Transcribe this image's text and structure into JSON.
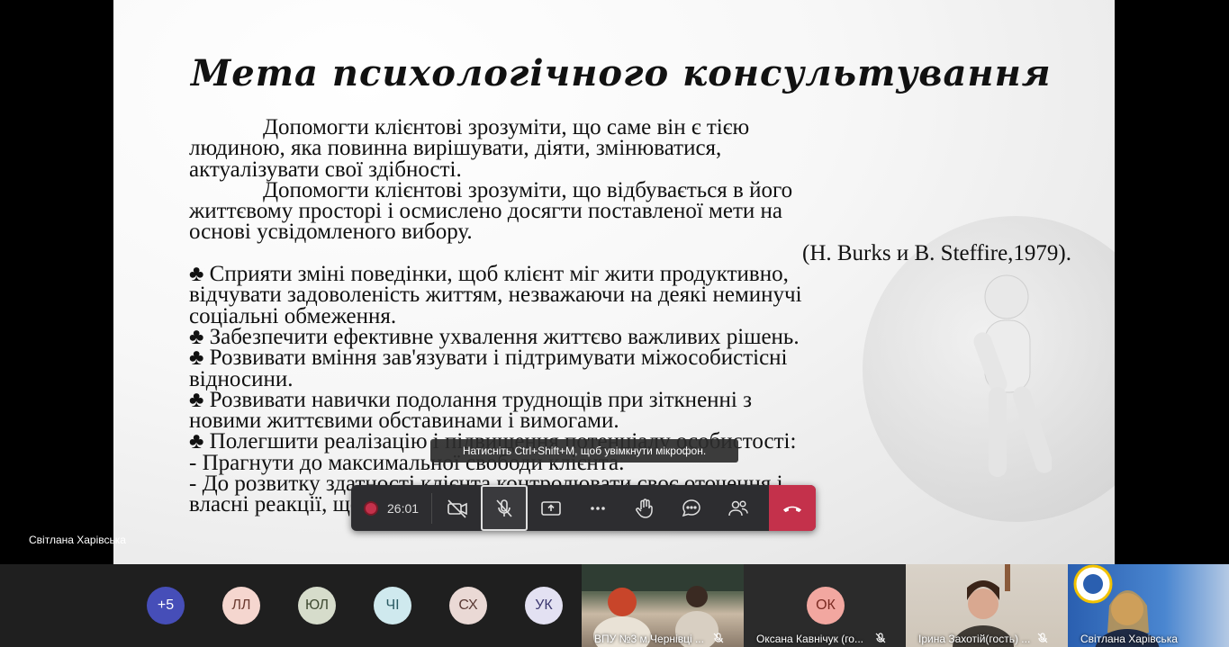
{
  "slide": {
    "title": "Мета психологічного консультування",
    "lines": [
      {
        "text": "Допомогти клієнтові зрозуміти, що саме він є тією",
        "cls": "indent"
      },
      {
        "text": "людиною, яка повинна вирішувати, діяти, змінюватися,",
        "cls": ""
      },
      {
        "text": "актуалізувати свої здібності.",
        "cls": ""
      },
      {
        "text": "Допомогти клієнтові зрозуміти, що відбувається в його",
        "cls": "indent"
      },
      {
        "text": "життєвому просторі і осмислено досягти поставленої мети на",
        "cls": ""
      },
      {
        "text": "основі усвідомленого вибору.",
        "cls": ""
      },
      {
        "text": "(H. Burks и B. Steffire,1979).",
        "cls": "citation"
      },
      {
        "text": "♣ Сприяти зміні поведінки, щоб клієнт міг жити продуктивно,",
        "cls": ""
      },
      {
        "text": "відчувати задоволеність життям, незважаючи на деякі неминучі",
        "cls": ""
      },
      {
        "text": "соціальні обмеження.",
        "cls": ""
      },
      {
        "text": "♣ Забезпечити ефективне ухвалення життєво важливих рішень.",
        "cls": ""
      },
      {
        "text": "♣ Розвивати вміння зав'язувати і підтримувати міжособистісні",
        "cls": ""
      },
      {
        "text": "відносини.",
        "cls": ""
      },
      {
        "text": "♣ Розвивати навички подолання труднощів при зіткненні з",
        "cls": ""
      },
      {
        "text": "новими життєвими обставинами і вимогами.",
        "cls": ""
      },
      {
        "text": "♣ Полегшити реалізацію і підвищення потенціалу особистості:",
        "cls": ""
      },
      {
        "text": "- Прагнути до максимальної свободи клієнта.",
        "cls": ""
      },
      {
        "text": "- До розвитку здатності клієнта контролювати своє оточення і",
        "cls": ""
      },
      {
        "text": "власні реакції, що провокуються оточенням.",
        "cls": ""
      }
    ]
  },
  "tooltip": "Натисніть Ctrl+Shift+M, щоб увімкнути мікрофон.",
  "toolbar": {
    "recording_time": "26:01",
    "buttons": [
      {
        "name": "camera-off-button",
        "icon": "camera-off-icon"
      },
      {
        "name": "mic-off-button",
        "icon": "mic-off-icon",
        "active": true
      },
      {
        "name": "share-screen-button",
        "icon": "share-icon"
      },
      {
        "name": "more-actions-button",
        "icon": "more-icon"
      },
      {
        "name": "raise-hand-button",
        "icon": "hand-icon"
      },
      {
        "name": "chat-button",
        "icon": "chat-icon"
      },
      {
        "name": "participants-button",
        "icon": "people-icon"
      }
    ],
    "hangup": {
      "name": "hangup-button",
      "icon": "phone-hangup-icon"
    }
  },
  "speaker_name": "Світлана Харівська",
  "participants": {
    "more_count": "+5",
    "avatars": [
      {
        "initials": "ЛЛ",
        "bg": "#f5d6cf",
        "fg": "#6b3a30"
      },
      {
        "initials": "ЮЛ",
        "bg": "#d6dccb",
        "fg": "#3f4a32"
      },
      {
        "initials": "ЧІ",
        "bg": "#cfe9ee",
        "fg": "#2a5a62"
      },
      {
        "initials": "СХ",
        "bg": "#ead9d5",
        "fg": "#5a3a35"
      },
      {
        "initials": "УК",
        "bg": "#e3e1f2",
        "fg": "#3c3870"
      }
    ],
    "tiles": [
      {
        "name": "ВПУ №3 м.Чернівці ...",
        "type": "video"
      },
      {
        "name": "Оксана Кавнічук (го...",
        "type": "avatar",
        "initials": "ОК",
        "bg": "#f2a7a0",
        "fg": "#7a2a22"
      },
      {
        "name": "Ірина Захотій(гость) ...",
        "type": "video"
      },
      {
        "name": "Світлана Харівська",
        "type": "video"
      }
    ]
  },
  "colors": {
    "accent": "#464eb8",
    "hangup": "#c4314b",
    "toolbar": "#2d2d30"
  }
}
